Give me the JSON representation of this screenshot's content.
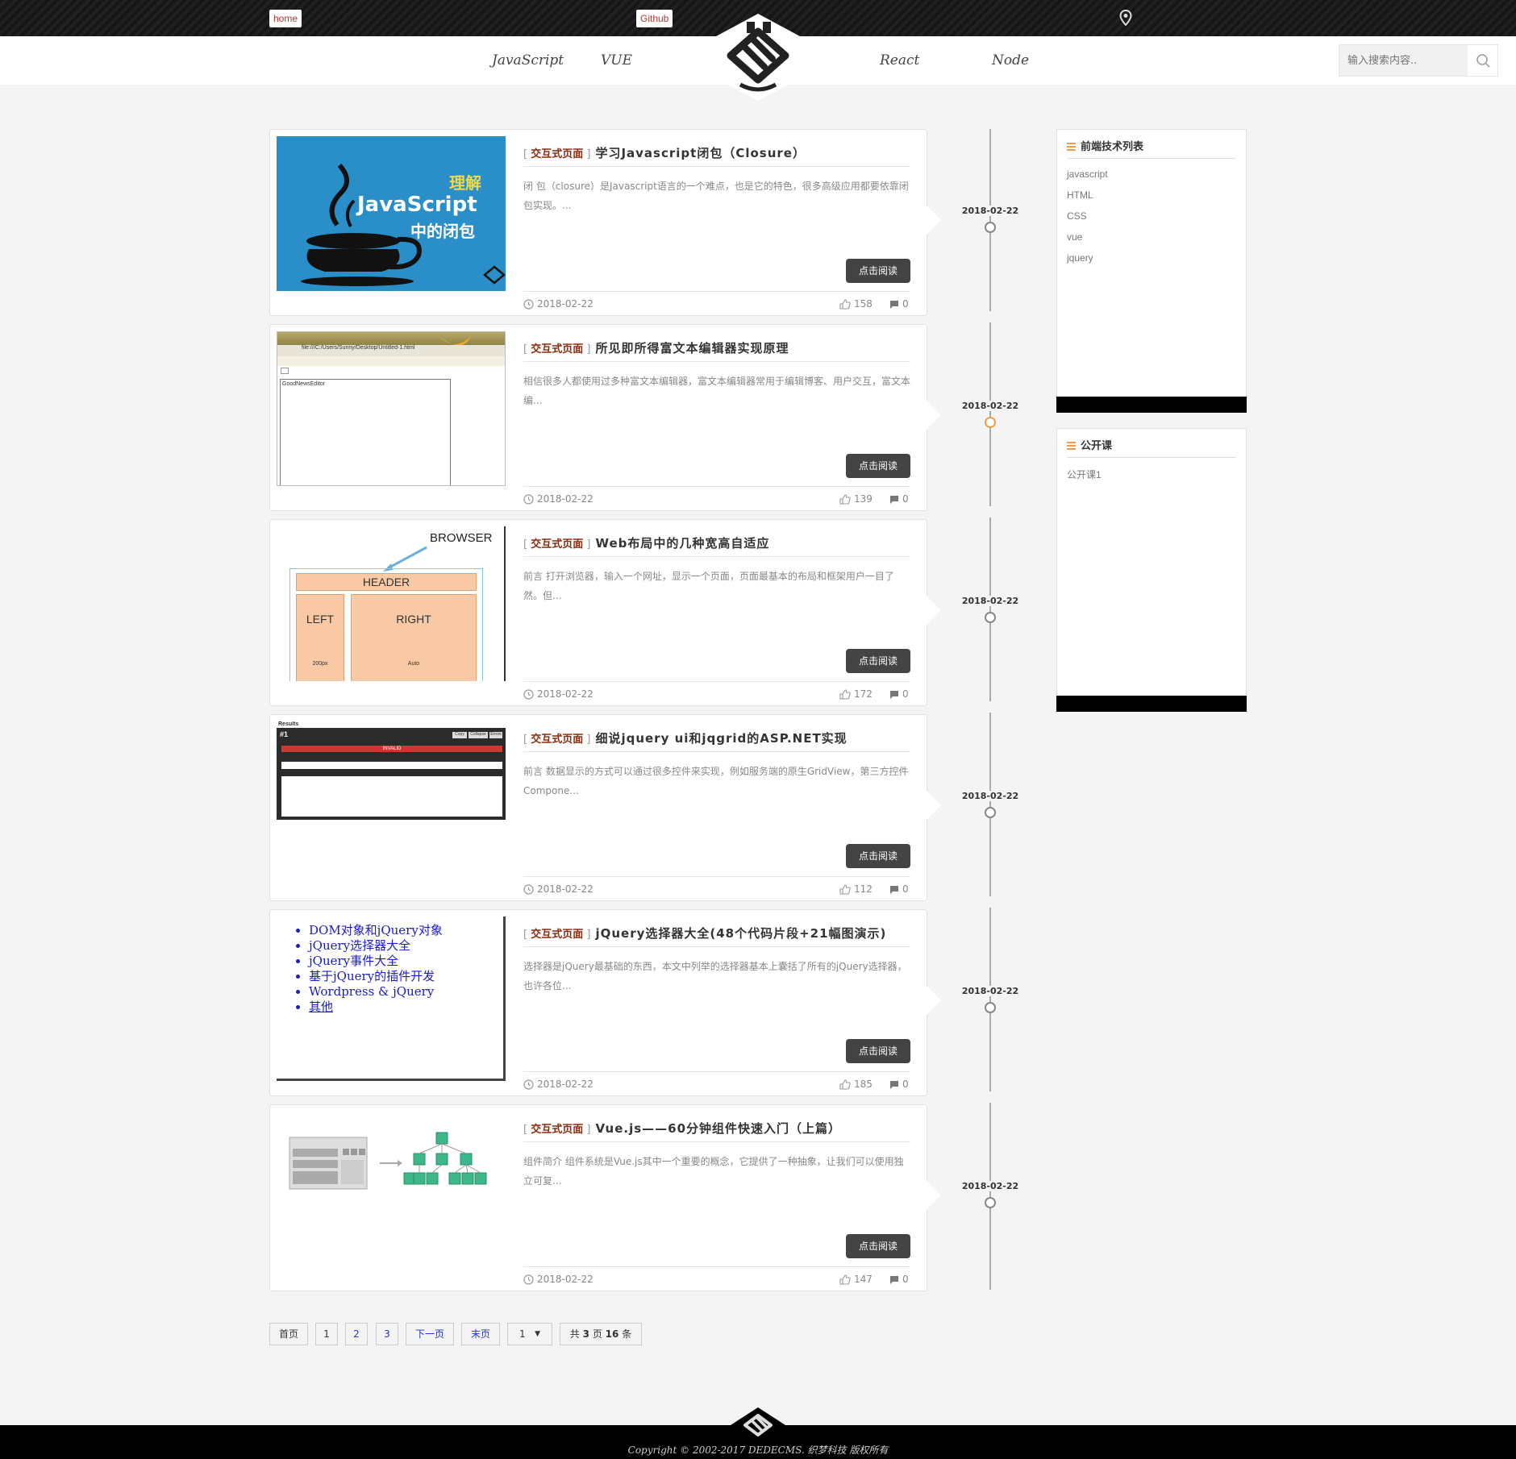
{
  "top": {
    "home_label": "home",
    "github_label": "Github",
    "location_icon": "map-pin-icon"
  },
  "nav": {
    "items": [
      "JavaScript",
      "VUE",
      "React",
      "Node"
    ],
    "search_placeholder": "输入搜索内容.."
  },
  "articles": [
    {
      "tag": "交互式页面",
      "title": "学习Javascript闭包（Closure）",
      "summary": "闭 包（closure）是Javascript语言的一个难点，也是它的特色，很多高级应用都要依靠闭包实现。...",
      "button": "点击阅读",
      "date": "2018-02-22",
      "likes": "158",
      "comments": "0"
    },
    {
      "tag": "交互式页面",
      "title": "所见即所得富文本编辑器实现原理",
      "summary": "相信很多人都使用过多种富文本编辑器，富文本编辑器常用于编辑博客、用户交互，富文本编...",
      "button": "点击阅读",
      "date": "2018-02-22",
      "likes": "139",
      "comments": "0"
    },
    {
      "tag": "交互式页面",
      "title": "Web布局中的几种宽高自适应",
      "summary": "前言 打开浏览器，输入一个网址，显示一个页面，页面最基本的布局和框架用户一目了然。但...",
      "button": "点击阅读",
      "date": "2018-02-22",
      "likes": "172",
      "comments": "0"
    },
    {
      "tag": "交互式页面",
      "title": "细说jquery ui和jqgrid的ASP.NET实现",
      "summary": "前言 数据显示的方式可以通过很多控件来实现，例如服务端的原生GridView，第三方控件Compone...",
      "button": "点击阅读",
      "date": "2018-02-22",
      "likes": "112",
      "comments": "0"
    },
    {
      "tag": "交互式页面",
      "title": "jQuery选择器大全(48个代码片段+21幅图演示)",
      "summary": "选择器是jQuery最基础的东西，本文中列举的选择器基本上囊括了所有的jQuery选择器，也许各位...",
      "button": "点击阅读",
      "date": "2018-02-22",
      "likes": "185",
      "comments": "0"
    },
    {
      "tag": "交互式页面",
      "title": "Vue.js——60分钟组件快速入门（上篇）",
      "summary": "组件简介 组件系统是Vue.js其中一个重要的概念，它提供了一种抽象，让我们可以使用独立可复...",
      "button": "点击阅读",
      "date": "2018-02-22",
      "likes": "147",
      "comments": "0"
    }
  ],
  "thumbs": {
    "js": {
      "line1": "理解",
      "line2": "JavaScript",
      "line3": "中的闭包"
    },
    "editor": {
      "url": "file:///C:/Users/Sunny/Desktop/Untitled-1.html",
      "label": "GoodNewsEditor"
    },
    "layout": {
      "browser": "BROWSER",
      "header": "HEADER",
      "left": "LEFT",
      "right": "RIGHT",
      "w1": "200px",
      "w2": "Auto"
    },
    "grid": {
      "results": "Results",
      "num": "#1",
      "invalid": "INVALID",
      "b1": "Copy",
      "b2": "Collapse",
      "b3": "Errors"
    },
    "jq_list": [
      "DOM对象和jQuery对象",
      "jQuery选择器大全",
      "jQuery事件大全",
      "基于jQuery的插件开发",
      "Wordpress & jQuery",
      "其他"
    ]
  },
  "timeline": {
    "dates": [
      "2018-02-22",
      "2018-02-22",
      "2018-02-22",
      "2018-02-22",
      "2018-02-22",
      "2018-02-22"
    ],
    "active_index": 1,
    "active_color": "#f0a040"
  },
  "sidebar": {
    "tech_title": "前端技术列表",
    "tech_items": [
      "javascript",
      "HTML",
      "CSS",
      "vue",
      "jquery"
    ],
    "course_title": "公开课",
    "course_items": [
      "公开课1"
    ]
  },
  "pagination": {
    "first": "首页",
    "pages": [
      "1",
      "2",
      "3"
    ],
    "next": "下一页",
    "last": "末页",
    "select_value": "1",
    "total_prefix": "共",
    "total_pages": "3",
    "pages_word": "页",
    "total_items": "16",
    "items_word": "条"
  },
  "footer": {
    "copyright": "Copyright © 2002-2017 DEDECMS. 织梦科技 版权所有"
  },
  "colors": {
    "tag": "#8a2b0e",
    "button": "#444444",
    "link_blue": "#2233cc",
    "accent_orange": "#f29b4b"
  }
}
